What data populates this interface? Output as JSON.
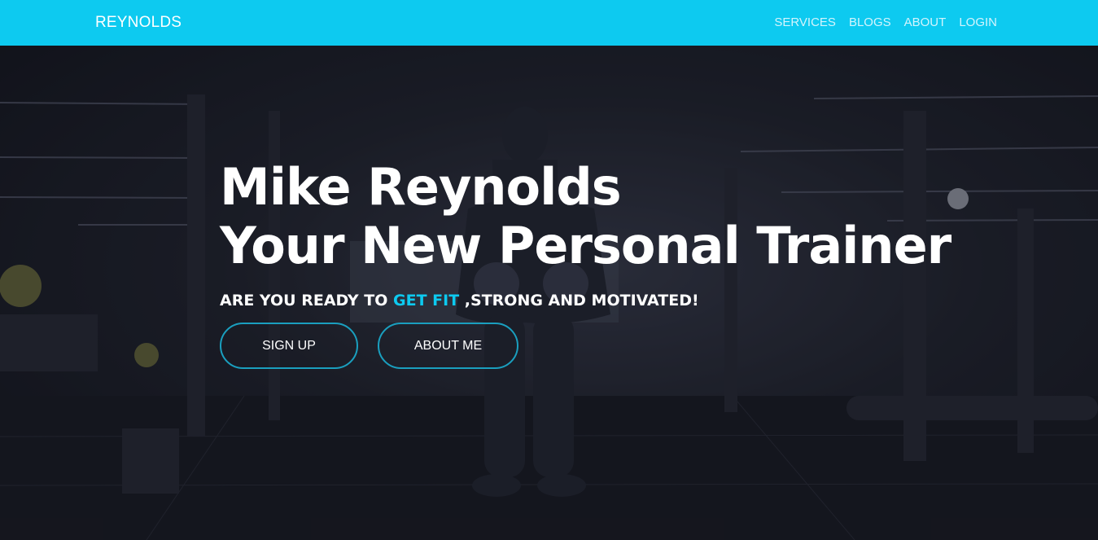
{
  "nav": {
    "brand": "REYNOLDS",
    "links": [
      "SERVICES",
      "BLOGS",
      "ABOUT",
      "LOGIN"
    ]
  },
  "hero": {
    "title_line1": "Mike Reynolds",
    "title_line2": "Your New Personal Trainer",
    "subtitle_pre": "ARE YOU READY TO ",
    "subtitle_accent": "GET FIT",
    "subtitle_post": " ,STRONG AND MOTIVATED!",
    "buttons": {
      "signup": "SIGN UP",
      "about": "ABOUT ME"
    }
  },
  "colors": {
    "accent": "#0dcaf0",
    "button_border": "#1a9fbf",
    "hero_bg": "#15161d"
  }
}
